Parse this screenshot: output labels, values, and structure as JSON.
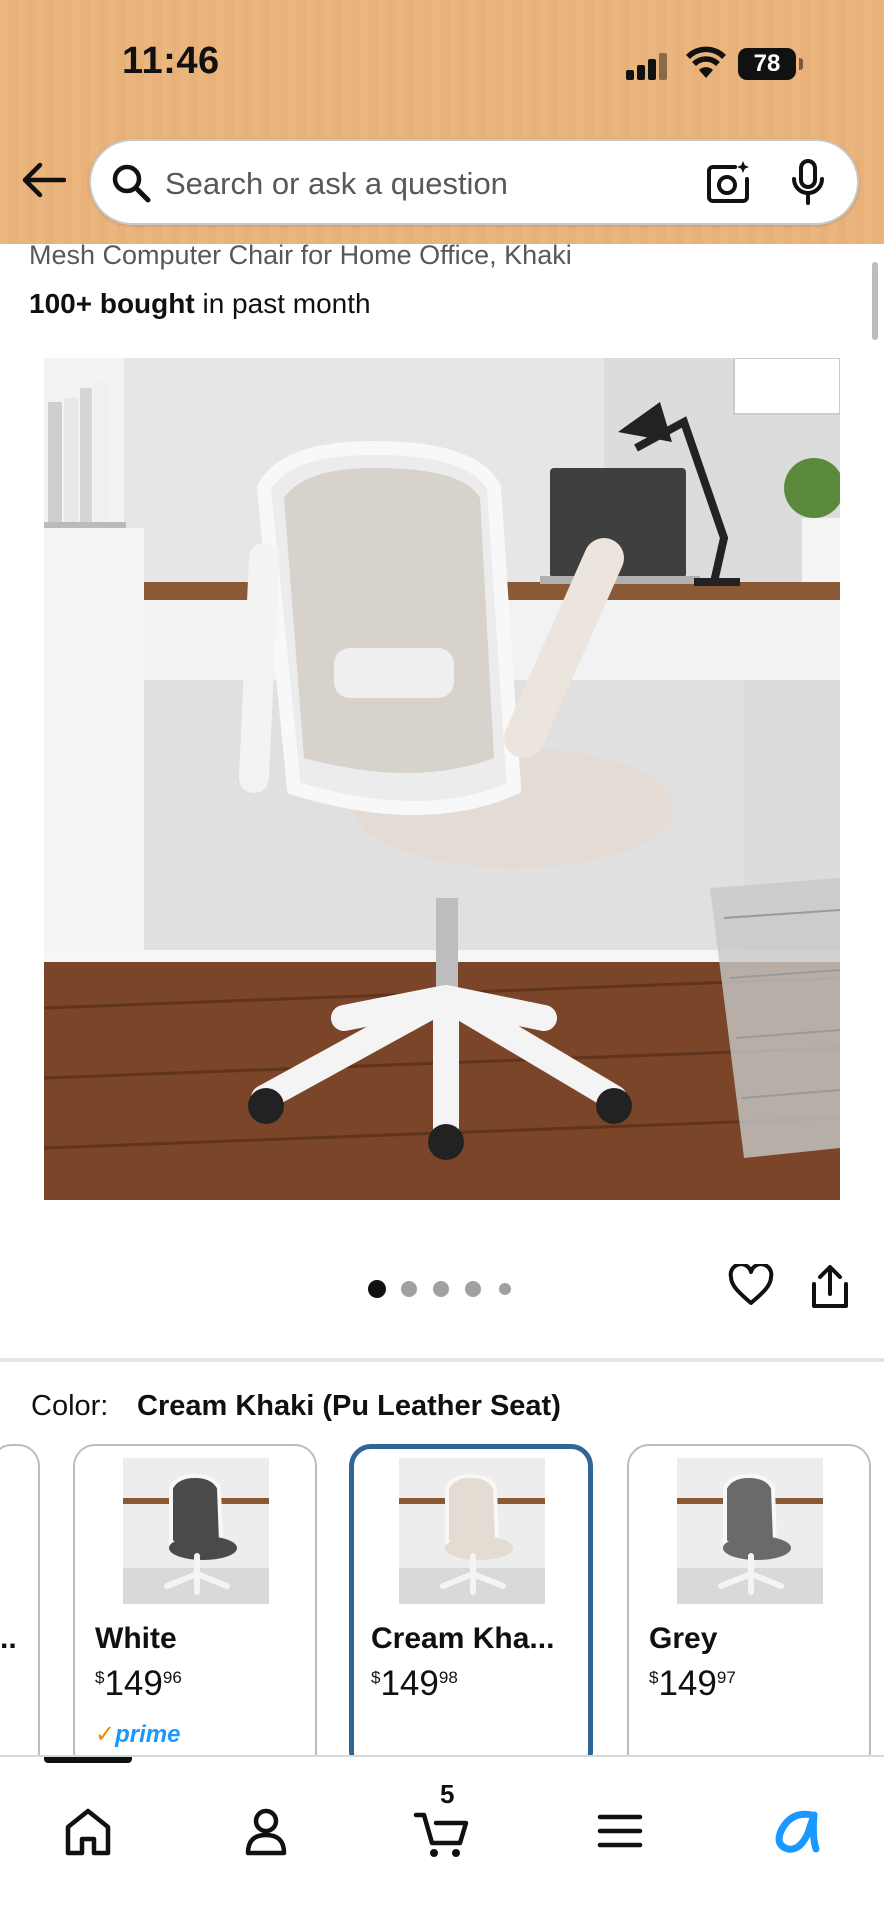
{
  "status_bar": {
    "time": "11:46",
    "battery": "78"
  },
  "search": {
    "placeholder": "Search or ask a question"
  },
  "product": {
    "title": "Mesh Computer Chair for Home Office, Khaki",
    "bought_bold": "100+ bought",
    "bought_rest": " in past month",
    "image_count": 5,
    "active_image": 1
  },
  "color": {
    "label": "Color:",
    "selected": "Cream Khaki (Pu Leather Seat)",
    "partial_left_label": ".."
  },
  "swatches": [
    {
      "name": "White",
      "currency": "$",
      "whole": "149",
      "fraction": "96",
      "prime": "prime",
      "selected": false,
      "seat_color": "#4a4a4a"
    },
    {
      "name": "Cream Kha...",
      "currency": "$",
      "whole": "149",
      "fraction": "98",
      "prime": "",
      "selected": true,
      "seat_color": "#e3dcd2"
    },
    {
      "name": "Grey",
      "currency": "$",
      "whole": "149",
      "fraction": "97",
      "prime": "",
      "selected": false,
      "seat_color": "#6a6a6a"
    }
  ],
  "bottom_nav": {
    "items": [
      "home-icon",
      "account-icon",
      "cart-icon",
      "menu-icon",
      "rufus-icon"
    ],
    "cart_count": "5"
  },
  "colors": {
    "header_bg": "#ebb57e",
    "selected_border": "#2f6696",
    "prime_blue": "#1a98ff",
    "rufus_blue": "#1a98ff"
  }
}
